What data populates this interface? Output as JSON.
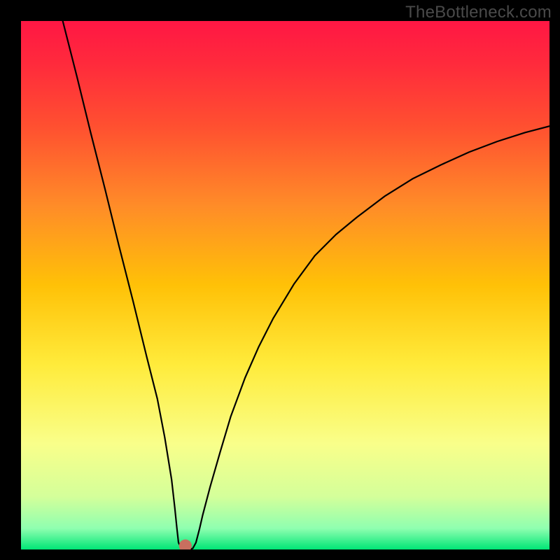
{
  "watermark": "TheBottleneck.com",
  "chart_data": {
    "type": "line",
    "source": "TheBottleneck.com",
    "description": "Bottleneck curve showing mismatch severity over a rainbow gradient. The curve has a sharp V-shaped minimum indicating the optimal balance point.",
    "xlabel": "",
    "ylabel": "",
    "xlim": [
      0,
      100
    ],
    "ylim": [
      0,
      100
    ],
    "gradient_stops": [
      {
        "pos": 0.0,
        "color": "#ff1744"
      },
      {
        "pos": 0.08,
        "color": "#ff2a3c"
      },
      {
        "pos": 0.2,
        "color": "#ff5030"
      },
      {
        "pos": 0.35,
        "color": "#ff8c28"
      },
      {
        "pos": 0.5,
        "color": "#ffc107"
      },
      {
        "pos": 0.65,
        "color": "#ffeb3b"
      },
      {
        "pos": 0.8,
        "color": "#f9ff8a"
      },
      {
        "pos": 0.9,
        "color": "#d4ff9a"
      },
      {
        "pos": 0.96,
        "color": "#8fffb0"
      },
      {
        "pos": 1.0,
        "color": "#00e676"
      }
    ],
    "curve": [
      {
        "x": 7.9,
        "y": 100
      },
      {
        "x": 10.6,
        "y": 89.4
      },
      {
        "x": 13.2,
        "y": 78.8
      },
      {
        "x": 15.9,
        "y": 68.2
      },
      {
        "x": 18.5,
        "y": 57.6
      },
      {
        "x": 21.2,
        "y": 47.0
      },
      {
        "x": 23.8,
        "y": 36.4
      },
      {
        "x": 25.8,
        "y": 28.5
      },
      {
        "x": 27.2,
        "y": 21.2
      },
      {
        "x": 28.5,
        "y": 13.2
      },
      {
        "x": 29.1,
        "y": 7.9
      },
      {
        "x": 29.5,
        "y": 4.0
      },
      {
        "x": 29.8,
        "y": 1.3
      },
      {
        "x": 30.5,
        "y": 0.0
      },
      {
        "x": 31.8,
        "y": 0.0
      },
      {
        "x": 32.5,
        "y": 0.2
      },
      {
        "x": 33.1,
        "y": 1.3
      },
      {
        "x": 33.8,
        "y": 4.0
      },
      {
        "x": 34.4,
        "y": 6.6
      },
      {
        "x": 35.8,
        "y": 11.9
      },
      {
        "x": 37.7,
        "y": 18.5
      },
      {
        "x": 39.7,
        "y": 25.2
      },
      {
        "x": 42.4,
        "y": 32.5
      },
      {
        "x": 45.0,
        "y": 38.4
      },
      {
        "x": 47.7,
        "y": 43.7
      },
      {
        "x": 51.7,
        "y": 50.3
      },
      {
        "x": 55.6,
        "y": 55.6
      },
      {
        "x": 59.6,
        "y": 59.6
      },
      {
        "x": 63.6,
        "y": 62.9
      },
      {
        "x": 68.9,
        "y": 66.9
      },
      {
        "x": 74.2,
        "y": 70.2
      },
      {
        "x": 79.5,
        "y": 72.8
      },
      {
        "x": 84.8,
        "y": 75.2
      },
      {
        "x": 90.1,
        "y": 77.2
      },
      {
        "x": 95.4,
        "y": 78.9
      },
      {
        "x": 100.0,
        "y": 80.1
      }
    ],
    "marker": {
      "x": 31.1,
      "y": 0.7,
      "color": "#c86f5f",
      "radius": 1.2
    }
  }
}
